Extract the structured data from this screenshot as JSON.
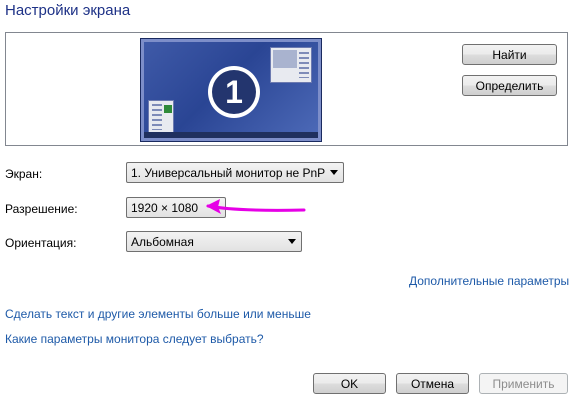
{
  "title": "Настройки экрана",
  "preview": {
    "monitor_number": "1"
  },
  "buttons": {
    "find": "Найти",
    "identify": "Определить",
    "ok": "OK",
    "cancel": "Отмена",
    "apply": "Применить"
  },
  "display": {
    "label": "Экран:",
    "value": "1. Универсальный монитор не PnP"
  },
  "resolution": {
    "label": "Разрешение:",
    "value": "1920 × 1080"
  },
  "orientation": {
    "label": "Ориентация:",
    "value": "Альбомная"
  },
  "links": {
    "advanced": "Дополнительные параметры",
    "text_size": "Сделать текст и другие элементы больше или меньше",
    "which_settings": "Какие параметры монитора следует выбрать?"
  },
  "colors": {
    "title": "#1e3287",
    "link": "#1e5aa8",
    "annotation_arrow": "#e600e6"
  },
  "icons": {
    "annotation": "arrow-left-icon"
  }
}
